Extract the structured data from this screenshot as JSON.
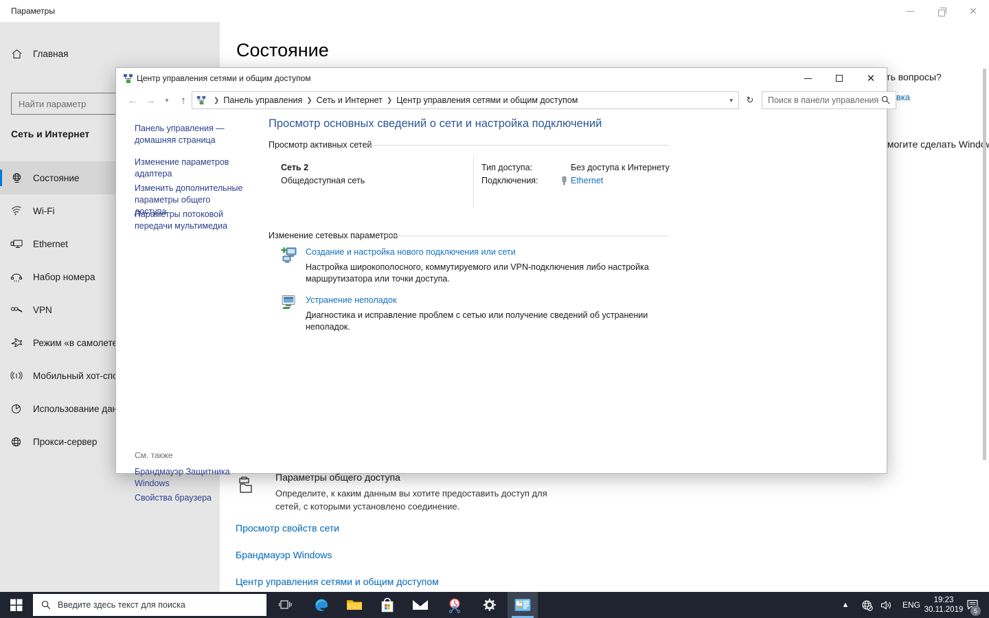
{
  "settings": {
    "window_title": "Параметры",
    "controls": {
      "minimize": "minimize-icon",
      "restore": "restore-icon",
      "close": "close-icon"
    },
    "home_label": "Главная",
    "search_placeholder": "Найти параметр",
    "group_title": "Сеть и Интернет",
    "page_title": "Состояние",
    "nav_items": [
      {
        "label": "Состояние",
        "icon": "status-globe-icon",
        "selected": true
      },
      {
        "label": "Wi-Fi",
        "icon": "wifi-icon",
        "selected": false
      },
      {
        "label": "Ethernet",
        "icon": "ethernet-icon",
        "selected": false
      },
      {
        "label": "Набор номера",
        "icon": "dialup-icon",
        "selected": false
      },
      {
        "label": "VPN",
        "icon": "vpn-icon",
        "selected": false
      },
      {
        "label": "Режим «в самолете»",
        "icon": "airplane-icon",
        "selected": false
      },
      {
        "label": "Мобильный хот-спот",
        "icon": "hotspot-icon",
        "selected": false
      },
      {
        "label": "Использование данных",
        "icon": "data-usage-icon",
        "selected": false
      },
      {
        "label": "Прокси-сервер",
        "icon": "proxy-globe-icon",
        "selected": false
      }
    ],
    "right_rail": {
      "questions_heading": "Есть вопросы?",
      "questions_link": "Справка",
      "improve_heading": "Помогите сделать Windows лучше"
    },
    "share_block": {
      "title": "Параметры общего доступа",
      "description": "Определите, к каким данным вы хотите предоставить доступ для сетей, с которыми установлено соединение."
    },
    "bottom_links": [
      "Просмотр свойств сети",
      "Брандмауэр Windows",
      "Центр управления сетями и общим доступом"
    ]
  },
  "control_panel": {
    "window_title": "Центр управления сетями и общим доступом",
    "title_icon": "network-sharing-icon",
    "controls": {
      "minimize": "minimize-icon",
      "maximize": "maximize-icon",
      "close": "close-icon"
    },
    "nav": {
      "back": "back-arrow-icon",
      "forward": "forward-arrow-icon",
      "history": "chevron-down-icon",
      "up": "up-arrow-icon",
      "refresh": "refresh-icon"
    },
    "breadcrumb": [
      "Панель управления",
      "Сеть и Интернет",
      "Центр управления сетями и общим доступом"
    ],
    "search_placeholder": "Поиск в панели управления",
    "tasks": [
      "Панель управления — домашняя страница",
      "Изменение параметров адаптера",
      "Изменить дополнительные параметры общего доступа",
      "Параметры потоковой передачи мультимедиа"
    ],
    "see_also_header": "См. также",
    "see_also": [
      "Брандмауэр Защитника Windows",
      "Свойства браузера"
    ],
    "heading": "Просмотр основных сведений о сети и настройка подключений",
    "sections": [
      {
        "title": "Просмотр активных сетей"
      },
      {
        "title": "Изменение сетевых параметров"
      }
    ],
    "active_network": {
      "name": "Сеть 2",
      "type": "Общедоступная сеть",
      "access_label": "Тип доступа:",
      "access_value": "Без доступа к Интернету",
      "connections_label": "Подключения:",
      "connection_link": "Ethernet",
      "connection_icon": "ethernet-plug-icon"
    },
    "actions": [
      {
        "link": "Создание и настройка нового подключения или сети",
        "description": "Настройка широкополосного, коммутируемого или VPN-подключения либо настройка маршрутизатора или точки доступа.",
        "icon": "new-connection-icon"
      },
      {
        "link": "Устранение неполадок",
        "description": "Диагностика и исправление проблем с сетью или получение сведений об устранении неполадок.",
        "icon": "troubleshoot-icon"
      }
    ]
  },
  "taskbar": {
    "start_icon": "windows-start-icon",
    "search_placeholder": "Введите здесь текст для поиска",
    "search_icon": "search-icon",
    "apps": [
      {
        "name": "task-view-icon"
      },
      {
        "name": "edge-icon"
      },
      {
        "name": "file-explorer-icon"
      },
      {
        "name": "microsoft-store-icon"
      },
      {
        "name": "mail-icon"
      },
      {
        "name": "snipping-tool-icon"
      },
      {
        "name": "settings-gear-icon"
      },
      {
        "name": "control-panel-icon",
        "active": true
      }
    ],
    "tray": {
      "chevron": "▲",
      "network_icon": "network-no-internet-icon",
      "volume_icon": "speaker-icon",
      "language": "ENG",
      "time": "19:23",
      "date": "30.11.2019",
      "action_center_icon": "action-center-icon",
      "notification_count": "5"
    }
  },
  "colors": {
    "accent": "#0078d7",
    "link": "#0067b8",
    "cp_link": "#1570bd",
    "cp_task_link": "#2b3f8c",
    "cp_heading": "#2b5797",
    "sidebar_bg": "#e6e6e6",
    "taskbar_bg": "#1f2430"
  }
}
